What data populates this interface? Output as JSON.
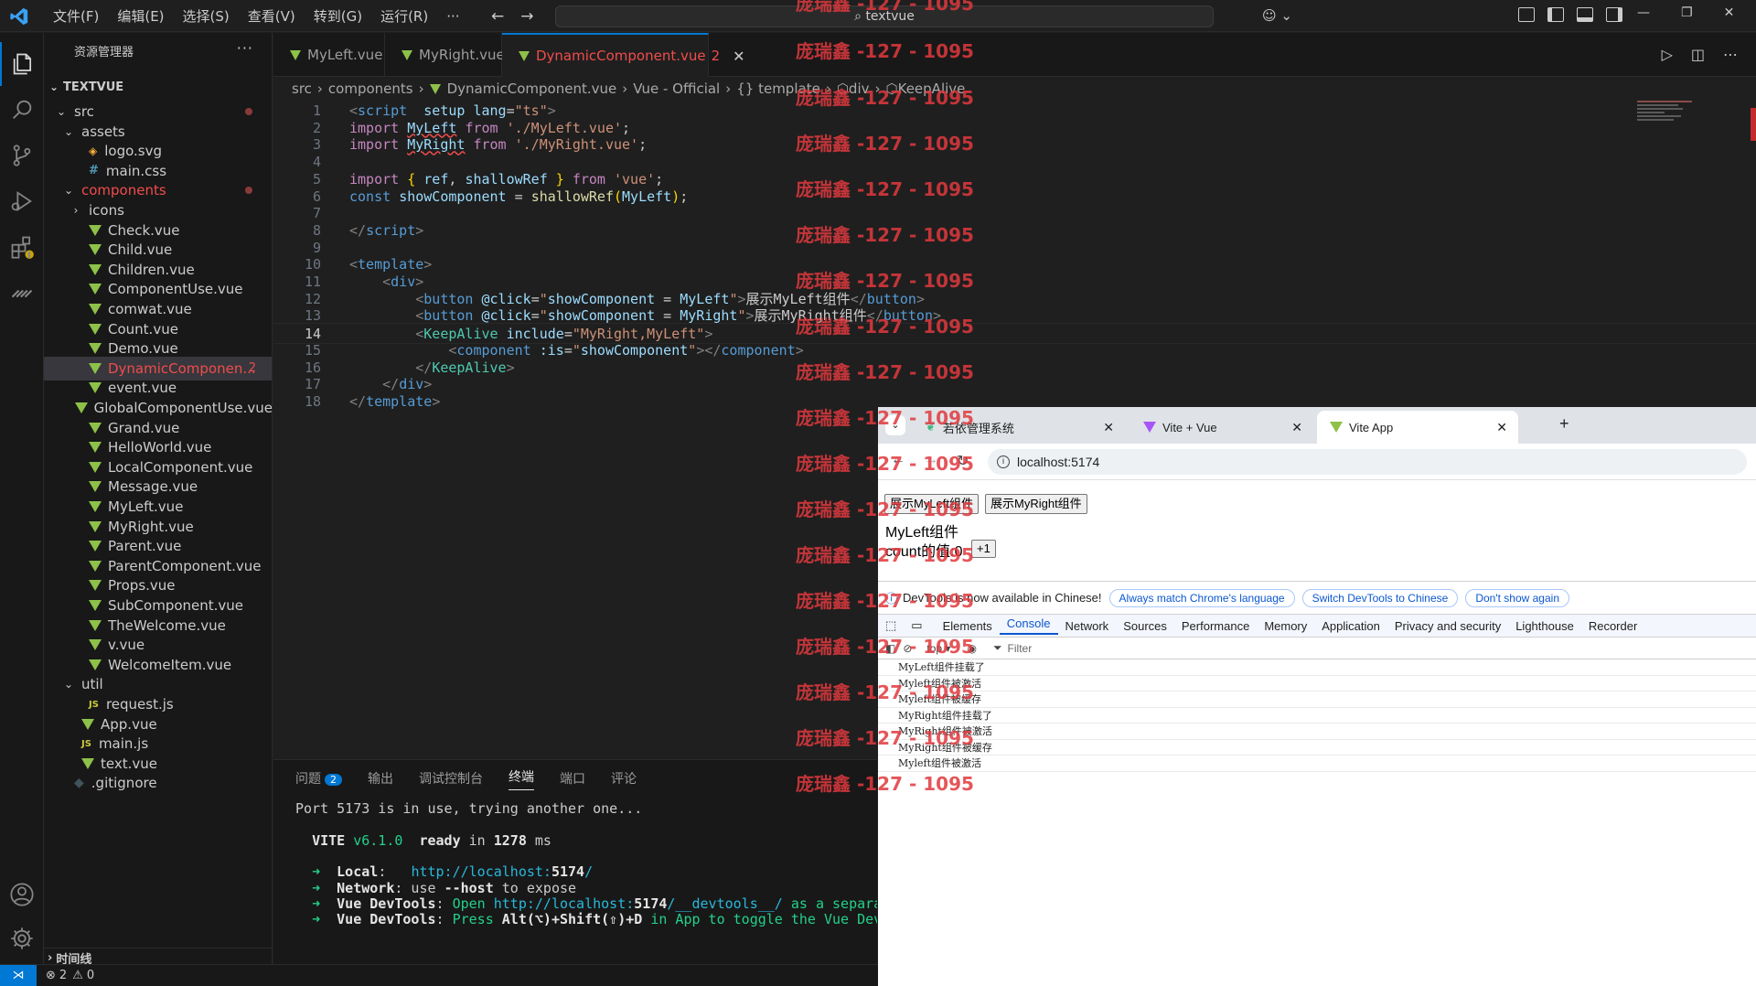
{
  "titlebar": {
    "menu": [
      "文件(F)",
      "编辑(E)",
      "选择(S)",
      "查看(V)",
      "转到(G)",
      "运行(R)",
      "···"
    ],
    "search": "textvue"
  },
  "sidebar": {
    "title": "资源管理器",
    "more": "···",
    "root": "TEXTVUE",
    "items": [
      {
        "label": "src",
        "depth": 1,
        "kind": "folder",
        "open": true,
        "dot": true
      },
      {
        "label": "assets",
        "depth": 2,
        "kind": "folder",
        "open": true
      },
      {
        "label": "logo.svg",
        "depth": 3,
        "kind": "svg"
      },
      {
        "label": "main.css",
        "depth": 3,
        "kind": "css"
      },
      {
        "label": "components",
        "depth": 2,
        "kind": "folder",
        "open": true,
        "dot": true,
        "err": true
      },
      {
        "label": "icons",
        "depth": 3,
        "kind": "folder",
        "open": false
      },
      {
        "label": "Check.vue",
        "depth": 3,
        "kind": "vue"
      },
      {
        "label": "Child.vue",
        "depth": 3,
        "kind": "vue"
      },
      {
        "label": "Children.vue",
        "depth": 3,
        "kind": "vue"
      },
      {
        "label": "ComponentUse.vue",
        "depth": 3,
        "kind": "vue"
      },
      {
        "label": "comwat.vue",
        "depth": 3,
        "kind": "vue"
      },
      {
        "label": "Count.vue",
        "depth": 3,
        "kind": "vue"
      },
      {
        "label": "Demo.vue",
        "depth": 3,
        "kind": "vue"
      },
      {
        "label": "DynamicComponen...",
        "depth": 3,
        "kind": "vue",
        "selected": true,
        "err": true,
        "badge": "2"
      },
      {
        "label": "event.vue",
        "depth": 3,
        "kind": "vue"
      },
      {
        "label": "GlobalComponentUse.vue",
        "depth": 3,
        "kind": "vue"
      },
      {
        "label": "Grand.vue",
        "depth": 3,
        "kind": "vue"
      },
      {
        "label": "HelloWorld.vue",
        "depth": 3,
        "kind": "vue"
      },
      {
        "label": "LocalComponent.vue",
        "depth": 3,
        "kind": "vue"
      },
      {
        "label": "Message.vue",
        "depth": 3,
        "kind": "vue"
      },
      {
        "label": "MyLeft.vue",
        "depth": 3,
        "kind": "vue"
      },
      {
        "label": "MyRight.vue",
        "depth": 3,
        "kind": "vue"
      },
      {
        "label": "Parent.vue",
        "depth": 3,
        "kind": "vue"
      },
      {
        "label": "ParentComponent.vue",
        "depth": 3,
        "kind": "vue"
      },
      {
        "label": "Props.vue",
        "depth": 3,
        "kind": "vue"
      },
      {
        "label": "SubComponent.vue",
        "depth": 3,
        "kind": "vue"
      },
      {
        "label": "TheWelcome.vue",
        "depth": 3,
        "kind": "vue"
      },
      {
        "label": "v.vue",
        "depth": 3,
        "kind": "vue"
      },
      {
        "label": "WelcomeItem.vue",
        "depth": 3,
        "kind": "vue"
      },
      {
        "label": "util",
        "depth": 2,
        "kind": "folder",
        "open": true
      },
      {
        "label": "request.js",
        "depth": 3,
        "kind": "js"
      },
      {
        "label": "App.vue",
        "depth": 2,
        "kind": "vue"
      },
      {
        "label": "main.js",
        "depth": 2,
        "kind": "js"
      },
      {
        "label": "text.vue",
        "depth": 2,
        "kind": "vue"
      },
      {
        "label": ".gitignore",
        "depth": 1,
        "kind": "git"
      }
    ],
    "timeline": "时间线"
  },
  "tabs": [
    {
      "label": "MyLeft.vue"
    },
    {
      "label": "MyRight.vue"
    },
    {
      "label": "DynamicComponent.vue",
      "badge": "2",
      "active": true
    }
  ],
  "breadcrumb": [
    "src",
    "components",
    "DynamicComponent.vue",
    "Vue - Official",
    "{} template",
    "div",
    "KeepAlive"
  ],
  "watermark": "庞瑞鑫 -127 - 1095",
  "code": {
    "current_line": 14,
    "lines": [
      [
        [
          "tagp",
          "<"
        ],
        [
          "tag",
          "script"
        ],
        [
          "",
          "  "
        ],
        [
          "attr",
          "setup"
        ],
        [
          "",
          " "
        ],
        [
          "attr",
          "lang"
        ],
        [
          "",
          "="
        ],
        [
          "str",
          "\"ts\""
        ],
        [
          "tagp",
          ">"
        ]
      ],
      [
        [
          "kw",
          "import"
        ],
        [
          "",
          " "
        ],
        [
          "id squig",
          "MyLeft"
        ],
        [
          "",
          " "
        ],
        [
          "kw",
          "from"
        ],
        [
          "",
          " "
        ],
        [
          "str",
          "'./MyLeft.vue'"
        ],
        [
          "",
          ";"
        ]
      ],
      [
        [
          "kw",
          "import"
        ],
        [
          "",
          " "
        ],
        [
          "id squig",
          "MyRight"
        ],
        [
          "",
          " "
        ],
        [
          "kw",
          "from"
        ],
        [
          "",
          " "
        ],
        [
          "str",
          "'./MyRight.vue'"
        ],
        [
          "",
          ";"
        ]
      ],
      [],
      [
        [
          "kw",
          "import"
        ],
        [
          "",
          " "
        ],
        [
          "brk",
          "{"
        ],
        [
          "",
          " "
        ],
        [
          "id",
          "ref"
        ],
        [
          "",
          ", "
        ],
        [
          "id",
          "shallowRef"
        ],
        [
          "",
          " "
        ],
        [
          "brk",
          "}"
        ],
        [
          "",
          " "
        ],
        [
          "kw",
          "from"
        ],
        [
          "",
          " "
        ],
        [
          "str",
          "'vue'"
        ],
        [
          "",
          ";"
        ]
      ],
      [
        [
          "k",
          "const"
        ],
        [
          "",
          " "
        ],
        [
          "id",
          "showComponent"
        ],
        [
          "",
          " = "
        ],
        [
          "fn",
          "shallowRef"
        ],
        [
          "brk",
          "("
        ],
        [
          "id",
          "MyLeft"
        ],
        [
          "brk",
          ")"
        ],
        [
          "",
          ";"
        ]
      ],
      [],
      [
        [
          "tagp",
          "</"
        ],
        [
          "tag",
          "script"
        ],
        [
          "tagp",
          ">"
        ]
      ],
      [],
      [
        [
          "tagp",
          "<"
        ],
        [
          "tag",
          "template"
        ],
        [
          "tagp",
          ">"
        ]
      ],
      [
        [
          "",
          "    "
        ],
        [
          "tagp",
          "<"
        ],
        [
          "tag",
          "div"
        ],
        [
          "tagp",
          ">"
        ]
      ],
      [
        [
          "",
          "        "
        ],
        [
          "tagp",
          "<"
        ],
        [
          "tag",
          "button"
        ],
        [
          "",
          " "
        ],
        [
          "attr",
          "@click"
        ],
        [
          "",
          "="
        ],
        [
          "str",
          "\""
        ],
        [
          "id",
          "showComponent"
        ],
        [
          "",
          " = "
        ],
        [
          "id",
          "MyLeft"
        ],
        [
          "str",
          "\""
        ],
        [
          "tagp",
          ">"
        ],
        [
          "",
          "展示MyLeft组件"
        ],
        [
          "tagp",
          "</"
        ],
        [
          "tag",
          "button"
        ],
        [
          "tagp",
          ">"
        ]
      ],
      [
        [
          "",
          "        "
        ],
        [
          "tagp",
          "<"
        ],
        [
          "tag",
          "button"
        ],
        [
          "",
          " "
        ],
        [
          "attr",
          "@click"
        ],
        [
          "",
          "="
        ],
        [
          "str",
          "\""
        ],
        [
          "id",
          "showComponent"
        ],
        [
          "",
          " = "
        ],
        [
          "id",
          "MyRight"
        ],
        [
          "str",
          "\""
        ],
        [
          "tagp",
          ">"
        ],
        [
          "",
          "展示MyRight组件"
        ],
        [
          "tagp",
          "</"
        ],
        [
          "tag",
          "button"
        ],
        [
          "tagp",
          ">"
        ]
      ],
      [
        [
          "",
          "        "
        ],
        [
          "tagp",
          "<"
        ],
        [
          "comp",
          "KeepAlive"
        ],
        [
          "",
          " "
        ],
        [
          "attr",
          "include"
        ],
        [
          "",
          "="
        ],
        [
          "str",
          "\"MyRight,MyLeft\""
        ],
        [
          "tagp",
          ">"
        ]
      ],
      [
        [
          "",
          "            "
        ],
        [
          "tagp",
          "<"
        ],
        [
          "tag",
          "component"
        ],
        [
          "",
          " "
        ],
        [
          "attr",
          ":is"
        ],
        [
          "",
          "="
        ],
        [
          "str",
          "\""
        ],
        [
          "id",
          "showComponent"
        ],
        [
          "str",
          "\""
        ],
        [
          "tagp",
          "></"
        ],
        [
          "tag",
          "component"
        ],
        [
          "tagp",
          ">"
        ]
      ],
      [
        [
          "",
          "        "
        ],
        [
          "tagp",
          "</"
        ],
        [
          "comp",
          "KeepAlive"
        ],
        [
          "tagp",
          ">"
        ]
      ],
      [
        [
          "",
          "    "
        ],
        [
          "tagp",
          "</"
        ],
        [
          "tag",
          "div"
        ],
        [
          "tagp",
          ">"
        ]
      ],
      [
        [
          "tagp",
          "</"
        ],
        [
          "tag",
          "template"
        ],
        [
          "tagp",
          ">"
        ]
      ]
    ]
  },
  "panel": {
    "tabs": [
      "问题",
      "输出",
      "调试控制台",
      "终端",
      "端口",
      "评论"
    ],
    "problems_count": "2",
    "active_tab": "终端",
    "terminal": [
      [
        [
          "",
          "Port 5173 is in use, trying another one..."
        ]
      ],
      [],
      [
        [
          "",
          "  "
        ],
        [
          "g bold",
          "VITE"
        ],
        [
          "g",
          " v6.1.0"
        ],
        [
          "",
          "  "
        ],
        [
          "bold",
          "ready"
        ],
        [
          "",
          " in "
        ],
        [
          "bold",
          "1278"
        ],
        [
          "",
          " ms"
        ]
      ],
      [],
      [
        [
          "",
          "  "
        ],
        [
          "g",
          "➜"
        ],
        [
          "",
          "  "
        ],
        [
          "bold",
          "Local"
        ],
        [
          "",
          ":   "
        ],
        [
          "c",
          "http://localhost:"
        ],
        [
          "c bold",
          "5174"
        ],
        [
          "c",
          "/"
        ]
      ],
      [
        [
          "",
          "  "
        ],
        [
          "g",
          "➜"
        ],
        [
          "",
          "  "
        ],
        [
          "bold",
          "Network"
        ],
        [
          "",
          ": use "
        ],
        [
          "bold",
          "--host"
        ],
        [
          "",
          " to expose"
        ]
      ],
      [
        [
          "",
          "  "
        ],
        [
          "g",
          "➜"
        ],
        [
          "",
          "  "
        ],
        [
          "bold",
          "Vue DevTools"
        ],
        [
          "",
          ": "
        ],
        [
          "g",
          "Open "
        ],
        [
          "c",
          "http://localhost:"
        ],
        [
          "c bold",
          "5174"
        ],
        [
          "c",
          "/__devtools__/"
        ],
        [
          "g",
          " as a separa"
        ]
      ],
      [
        [
          "",
          "  "
        ],
        [
          "g",
          "➜"
        ],
        [
          "",
          "  "
        ],
        [
          "bold",
          "Vue DevTools"
        ],
        [
          "",
          ": "
        ],
        [
          "g",
          "Press "
        ],
        [
          "bold",
          "Alt(⌥)+Shift(⇧)+D"
        ],
        [
          "g",
          " in App to toggle the Vue Dev"
        ]
      ]
    ]
  },
  "status": {
    "errors": "2",
    "warnings": "0"
  },
  "browser": {
    "tabs": [
      {
        "label": "若依管理系统"
      },
      {
        "label": "Vite + Vue"
      },
      {
        "label": "Vite App",
        "active": true
      }
    ],
    "url": "localhost:5174",
    "page": {
      "btn_left": "展示MyLeft组件",
      "btn_right": "展示MyRight组件",
      "title": "MyLeft组件",
      "count_label": "count的值:0",
      "plus_btn": "+1"
    },
    "devtools": {
      "notice": "DevTools is now available in Chinese!",
      "chips": [
        "Always match Chrome's language",
        "Switch DevTools to Chinese",
        "Don't show again"
      ],
      "tabs": [
        "Elements",
        "Console",
        "Network",
        "Sources",
        "Performance",
        "Memory",
        "Application",
        "Privacy and security",
        "Lighthouse",
        "Recorder"
      ],
      "active_tab": "Console",
      "context": "top ▾",
      "filter": "Filter",
      "logs": [
        "MyLeft组件挂载了",
        "Myleft组件被激活",
        "Myleft组件被缓存",
        "MyRight组件挂载了",
        "MyRight组件被激活",
        "MyRight组件被缓存",
        "Myleft组件被激活"
      ]
    }
  }
}
